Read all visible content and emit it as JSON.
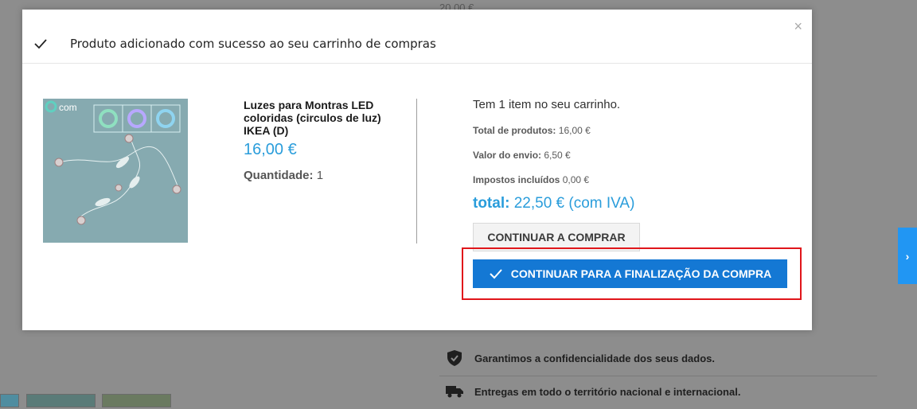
{
  "background": {
    "price_snippet": "20,00 €",
    "reassurance": [
      {
        "icon": "shield-check-icon",
        "text": "Garantimos a confidencialidade dos seus dados."
      },
      {
        "icon": "truck-icon",
        "text": "Entregas em todo o território nacional e internacional."
      }
    ],
    "side_tab_icon": "chevron-right-icon",
    "side_tab_glyph": "›"
  },
  "modal": {
    "title": "Produto adicionado com sucesso ao seu carrinho de compras",
    "close_glyph": "×",
    "product": {
      "name": "Luzes para Montras LED coloridas (circulos de luz) IKEA (D)",
      "price": "16,00 €",
      "quantity_label": "Quantidade:",
      "quantity_value": "1",
      "image_text": "com"
    },
    "cart": {
      "count_text": "Tem 1 item no seu carrinho.",
      "subtotal_label": "Total de produtos:",
      "subtotal_value": "16,00 €",
      "shipping_label": "Valor do envio:",
      "shipping_value": "6,50 €",
      "taxes_label": "Impostos incluídos",
      "taxes_value": "0,00 €",
      "total_label": "total:",
      "total_value": "22,50 € (com IVA)",
      "continue_label": "CONTINUAR A COMPRAR",
      "checkout_label": "CONTINUAR PARA A FINALIZAÇÃO DA COMPRA"
    }
  },
  "colors": {
    "accent": "#2a9ddb",
    "checkout_button": "#1478d4",
    "highlight": "#e0161b",
    "overlay": "#8d8d8d"
  }
}
